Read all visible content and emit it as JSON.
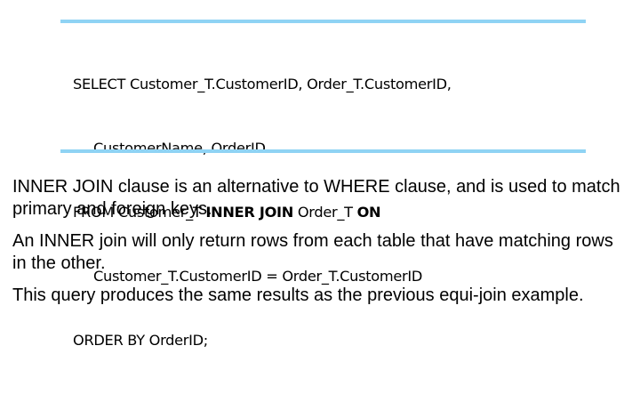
{
  "sql_example": {
    "line1": "SELECT Customer_T.CustomerID, Order_T.CustomerID,",
    "line2": "CustomerName, OrderID",
    "line3_from": "FROM Customer_T ",
    "line3_inner_join": "INNER JOIN",
    "line3_order_t": " Order_T ",
    "line3_on": "ON",
    "line4": "Customer_T.CustomerID = Order_T.CustomerID",
    "line5": "ORDER BY OrderID;"
  },
  "paragraphs": [
    "INNER JOIN clause is an alternative to WHERE clause, and is used to match primary and foreign keys.",
    "An INNER join will only return rows from each table that have matching rows in the other.",
    "This query produces the same results as the previous equi-join example."
  ],
  "colors": {
    "rule": "#8fd3f4",
    "text": "#000000",
    "background": "#ffffff"
  }
}
